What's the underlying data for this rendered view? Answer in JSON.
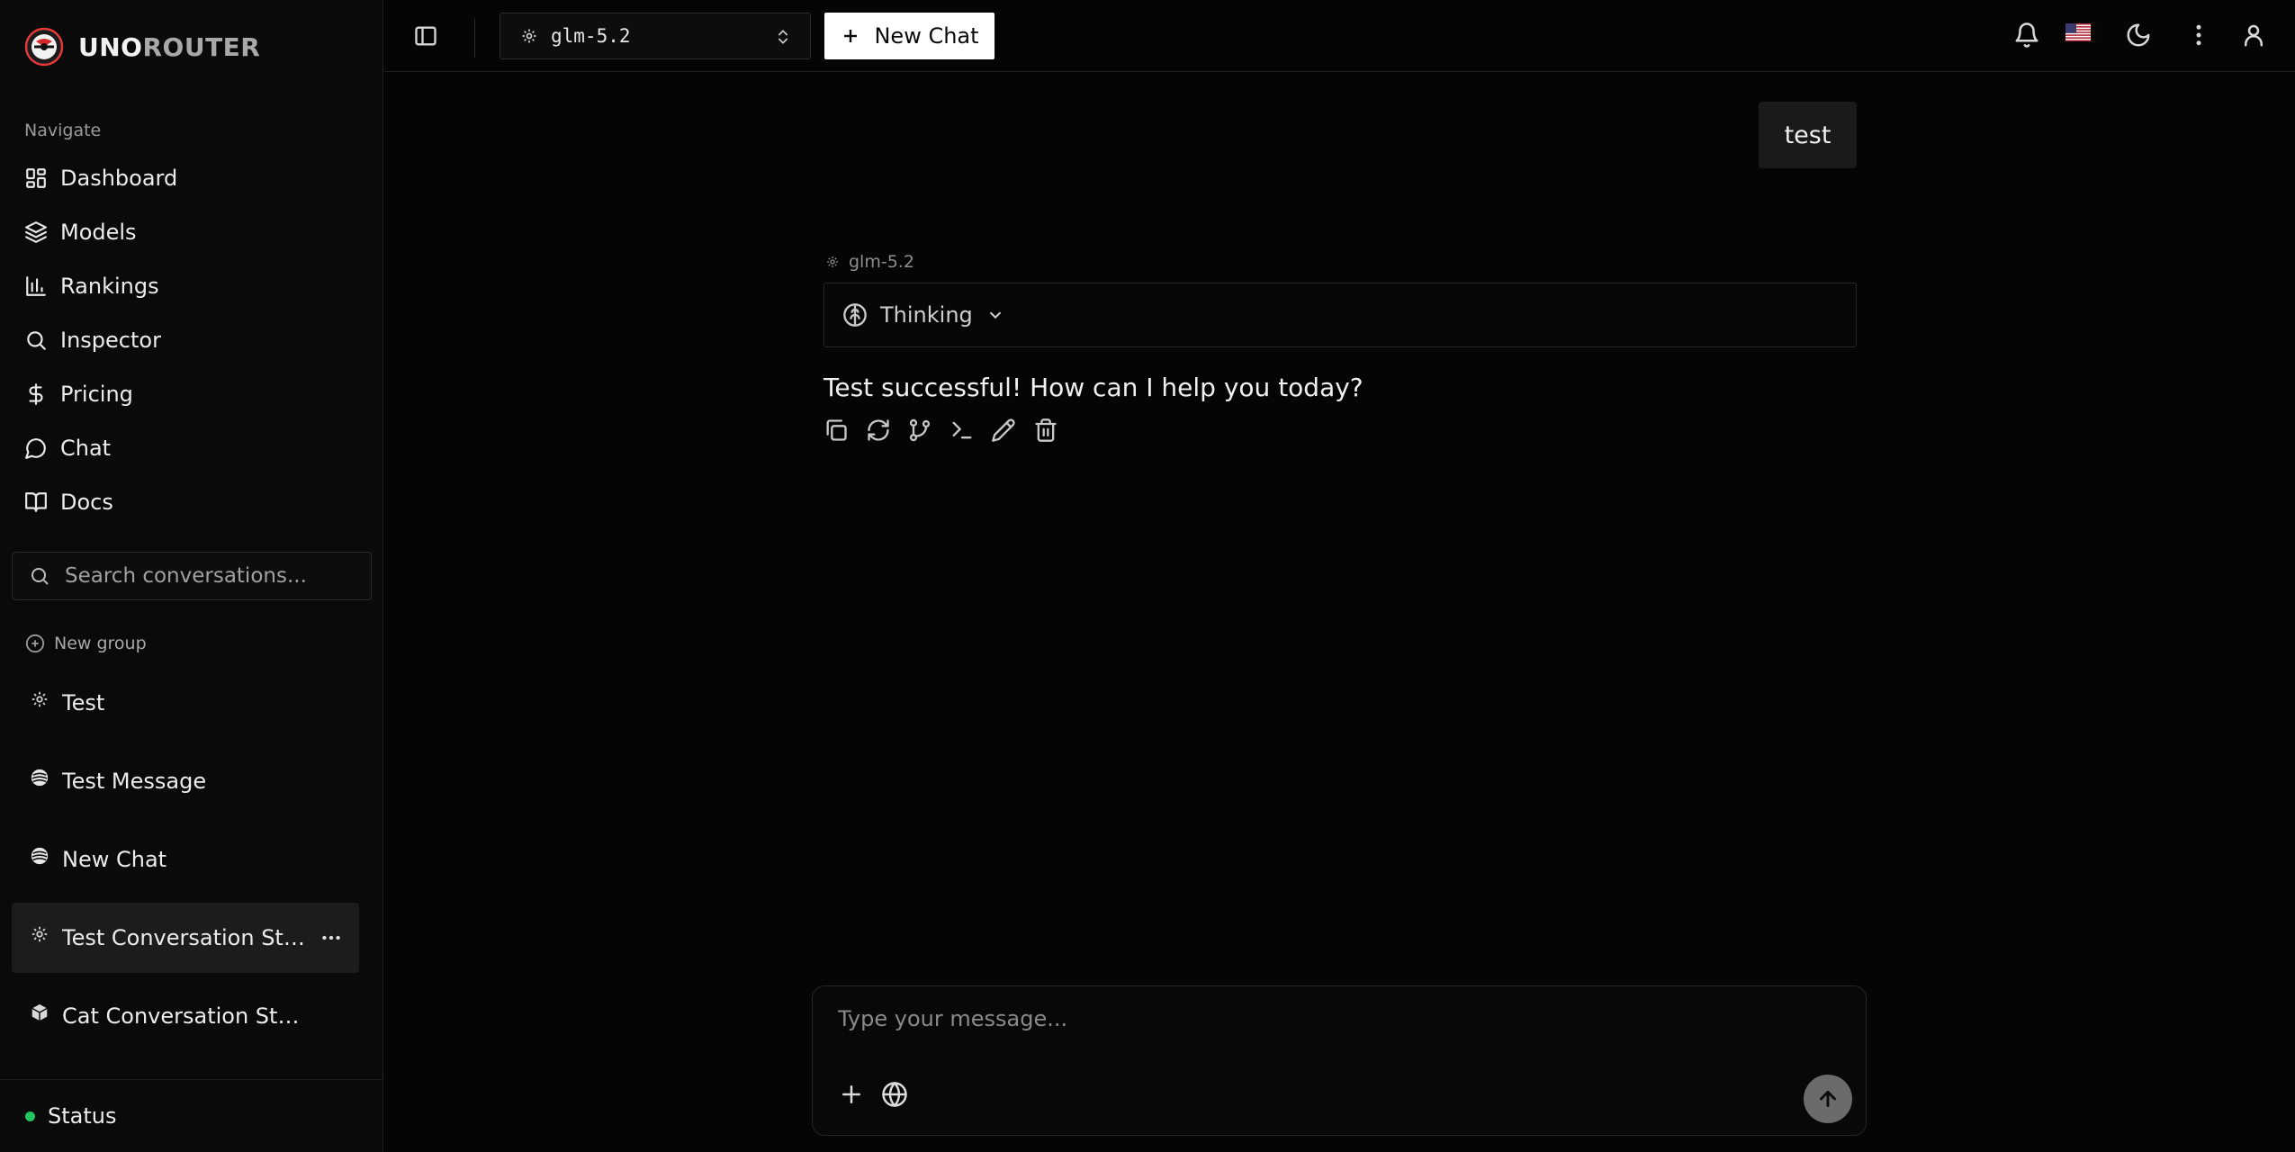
{
  "brand": {
    "name_part1": "UNO",
    "name_part2": "ROUTER"
  },
  "sidebar": {
    "nav_heading": "Navigate",
    "nav_items": [
      {
        "label": "Dashboard",
        "icon": "dashboard-icon"
      },
      {
        "label": "Models",
        "icon": "layers-icon"
      },
      {
        "label": "Rankings",
        "icon": "bar-chart-icon"
      },
      {
        "label": "Inspector",
        "icon": "search-icon"
      },
      {
        "label": "Pricing",
        "icon": "dollar-icon"
      },
      {
        "label": "Chat",
        "icon": "message-circle-icon"
      },
      {
        "label": "Docs",
        "icon": "book-open-icon"
      }
    ],
    "search_placeholder": "Search conversations...",
    "new_group_label": "New group",
    "conversations": [
      {
        "title": "Test",
        "icon": "sparkle-model-icon"
      },
      {
        "title": "Test Message",
        "icon": "openai-model-icon"
      },
      {
        "title": "New Chat",
        "icon": "openai-model-icon"
      },
      {
        "title": "Test Conversation Sta...",
        "icon": "sparkle-model-icon",
        "active": true
      },
      {
        "title": "Cat Conversation Started",
        "icon": "cube-model-icon"
      }
    ],
    "status_label": "Status",
    "status_color": "#22c55e"
  },
  "topbar": {
    "model": "glm-5.2",
    "new_chat_label": "New Chat",
    "icons": [
      "bell-icon",
      "us-flag-icon",
      "moon-icon",
      "more-vertical-icon",
      "user-icon"
    ]
  },
  "chat": {
    "user_message": "test",
    "assistant_model": "glm-5.2",
    "thinking_label": "Thinking",
    "assistant_message": "Test successful! How can I help you today?",
    "actions": [
      "copy-icon",
      "regenerate-icon",
      "branch-icon",
      "terminal-icon",
      "edit-icon",
      "delete-icon"
    ]
  },
  "composer": {
    "placeholder": "Type your message..."
  },
  "colors": {
    "background": "#050505",
    "sidebar": "#0a0a0a",
    "active_item": "#1c1c1c",
    "send_button": "#6b6b6b"
  }
}
